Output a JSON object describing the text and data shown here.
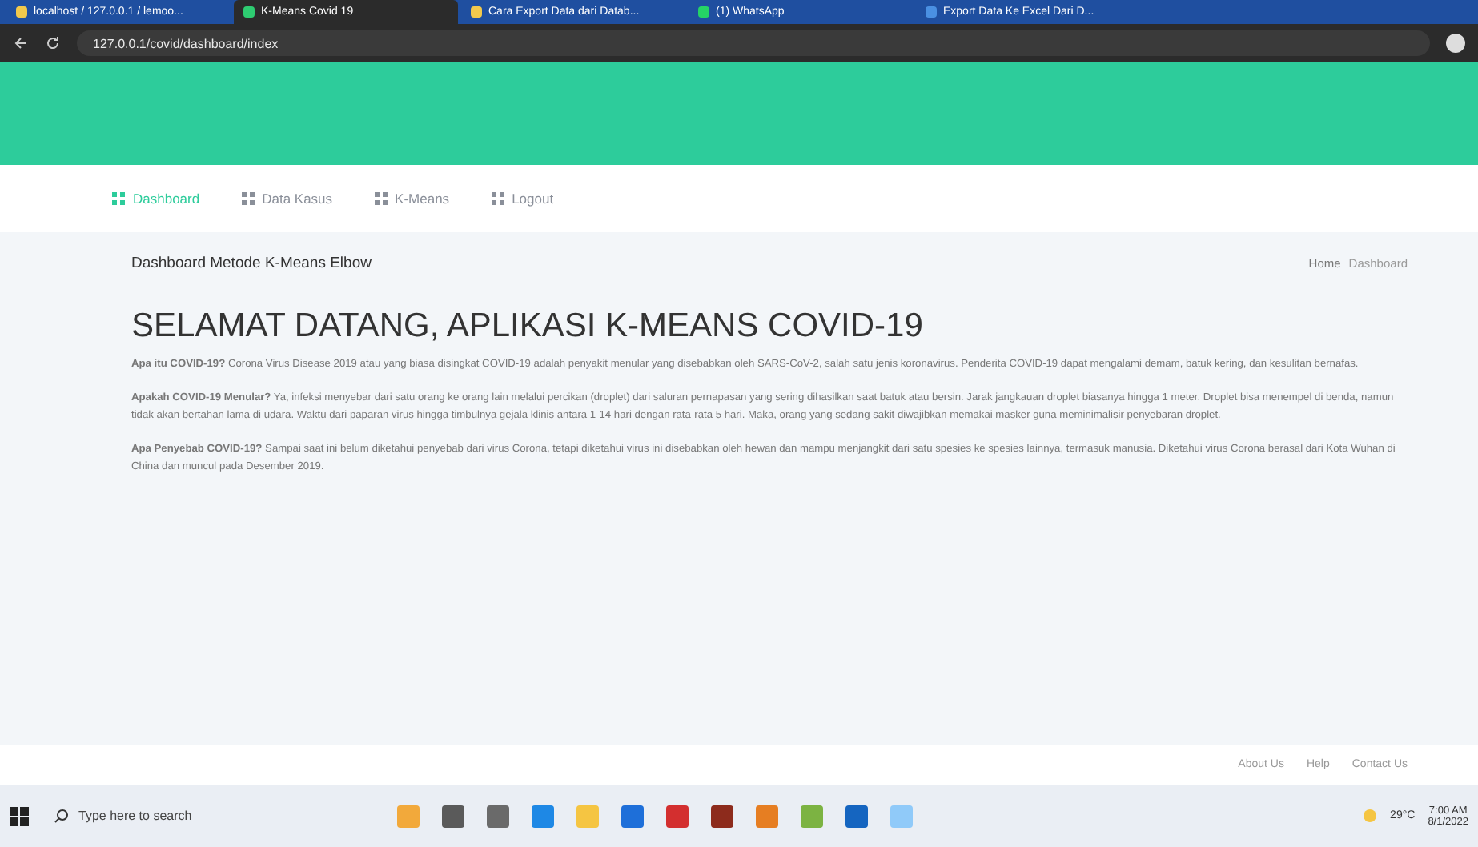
{
  "browser": {
    "tabs": [
      {
        "title": "localhost / 127.0.0.1 / lemoo...",
        "selected": false,
        "color": "#f2c94c"
      },
      {
        "title": "K-Means Covid 19",
        "selected": true,
        "color": "#2ecc71"
      },
      {
        "title": "Cara Export Data dari Datab...",
        "selected": false,
        "color": "#f2c94c"
      },
      {
        "title": "(1) WhatsApp",
        "selected": false,
        "color": "#25d366"
      },
      {
        "title": "Export Data Ke Excel Dari D...",
        "selected": false,
        "color": "#4a90e2"
      }
    ],
    "address": "127.0.0.1/covid/dashboard/index"
  },
  "nav": [
    {
      "label": "Dashboard",
      "selected": true
    },
    {
      "label": "Data Kasus",
      "selected": false
    },
    {
      "label": "K-Means",
      "selected": false
    },
    {
      "label": "Logout",
      "selected": false
    }
  ],
  "page_title": "Dashboard Metode K-Means Elbow",
  "breadcrumb": [
    "Home",
    "Dashboard"
  ],
  "heading": "SELAMAT DATANG, APLIKASI K-MEANS COVID-19",
  "paragraphs": [
    "**Apa itu COVID-19?** Corona Virus Disease 2019 atau yang biasa disingkat COVID-19 adalah penyakit menular yang disebabkan oleh SARS-CoV-2, salah satu jenis koronavirus. Penderita COVID-19 dapat mengalami demam, batuk kering, dan kesulitan bernafas.",
    "**Apakah COVID-19 Menular?** Ya, infeksi menyebar dari satu orang ke orang lain melalui percikan (droplet) dari saluran pernapasan yang sering dihasilkan saat batuk atau bersin. Jarak jangkauan droplet biasanya hingga 1 meter. Droplet bisa menempel di benda, namun tidak akan bertahan lama di udara. Waktu dari paparan virus hingga timbulnya gejala klinis antara 1-14 hari dengan rata-rata 5 hari. Maka, orang yang sedang sakit diwajibkan memakai masker guna meminimalisir penyebaran droplet.",
    "**Apa Penyebab COVID-19?** Sampai saat ini belum diketahui penyebab dari virus Corona, tetapi diketahui virus ini disebabkan oleh hewan dan mampu menjangkit dari satu spesies ke spesies lainnya, termasuk manusia. Diketahui virus Corona berasal dari Kota Wuhan di China dan muncul pada Desember 2019."
  ],
  "footer_links": [
    "About Us",
    "Help",
    "Contact Us"
  ],
  "taskbar": {
    "search_placeholder": "Type here to search",
    "weather": "29°C",
    "time": "7:00 AM",
    "date": "8/1/2022"
  }
}
